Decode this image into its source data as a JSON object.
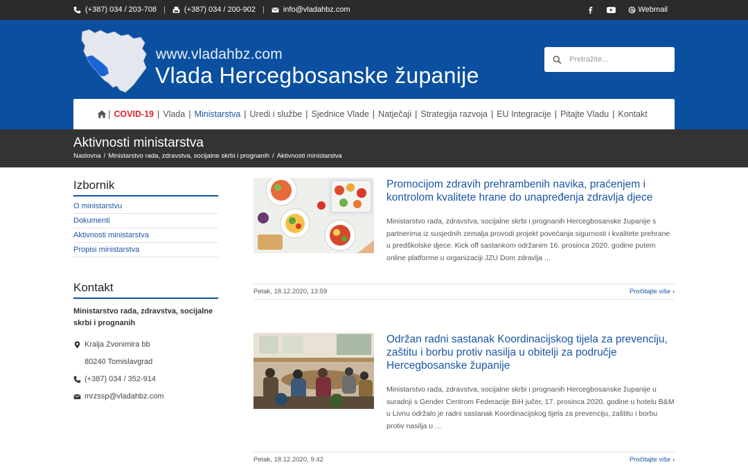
{
  "topbar": {
    "phone1": "(+387) 034 / 203-708",
    "fax": "(+387) 034 / 200-902",
    "email": "info@vladahbz.com",
    "webmail": "Webmail",
    "social": [
      "facebook-icon",
      "youtube-icon"
    ]
  },
  "header": {
    "url": "www.vladahbz.com",
    "title": "Vlada Hercegbosanske županije",
    "search_placeholder": "Pretražite..."
  },
  "nav": {
    "items": [
      {
        "label": "COVID-19",
        "style": "covid"
      },
      {
        "label": "Vlada",
        "style": ""
      },
      {
        "label": "Ministarstva",
        "style": "active"
      },
      {
        "label": "Uredi i službe",
        "style": ""
      },
      {
        "label": "Sjednice Vlade",
        "style": ""
      },
      {
        "label": "Natječaji",
        "style": ""
      },
      {
        "label": "Strategija razvoja",
        "style": ""
      },
      {
        "label": "EU Integracije",
        "style": ""
      },
      {
        "label": "Pitajte Vladu",
        "style": ""
      },
      {
        "label": "Kontakt",
        "style": ""
      }
    ],
    "separator": "|"
  },
  "page": {
    "title": "Aktivnosti ministarstva",
    "breadcrumb": [
      "Naslovna",
      "Ministarstvo rada, zdravstva, socijalne skrbi i prognanih",
      "Aktivnosti ministarstva"
    ],
    "breadcrumb_sep": "/"
  },
  "sidebar": {
    "menu_heading": "Izbornik",
    "menu": [
      "O ministarstvu",
      "Dokumenti",
      "Aktivnosti ministarstva",
      "Propisi ministarstva"
    ],
    "contact_heading": "Kontakt",
    "org": "Ministarstvo rada, zdravstva, socijalne skrbi i prognanih",
    "address1": "Kralja Zvonimira bb",
    "address2": "80240 Tomislavgrad",
    "phone": "(+387) 034 / 352-914",
    "email": "mrzssp@vladahbz.com"
  },
  "articles": [
    {
      "title": "Promocijom zdravih prehrambenih navika, praćenjem i kontrolom kvalitete hrane do unapređenja zdravlja djece",
      "excerpt": "Ministarstvo rada, zdravstva, socijalne skrbi i prognanih Hercegbosanske županije s partnerima iz susjednih zemalja provodi projekt povećanja sigurnosti i kvalitete prehrane u predškolske djece. Kick off sastankom održanim 16. prosinca 2020. godine putem online platforme u organizaciji JZU Dom zdravlja ...",
      "date": "Petak, 18.12.2020, 13:59",
      "more": "Pročitajte više"
    },
    {
      "title": "Održan radni sastanak Koordinacijskog tijela za prevenciju, zaštitu i borbu protiv nasilja u obitelji za područje Hercegbosanske županije",
      "excerpt": "Ministarstvo rada, zdravstva, socijalne skrbi i prognanih Hercegbosanske županije u suradnji s Gender Centrom Federacije BiH jučer, 17. prosinca 2020. godine u hotelu B&M u Livnu održalo je radni sastanak Koordinacijskog tijela za prevenciju, zaštitu i borbu protiv nasilja u ...",
      "date": "Petak, 18.12.2020, 9:42",
      "more": "Pročitajte više"
    }
  ],
  "colors": {
    "brand_blue": "#0b50a0",
    "link_blue": "#1a56a6",
    "covid_red": "#d8232a",
    "dark_bar": "#333333"
  }
}
